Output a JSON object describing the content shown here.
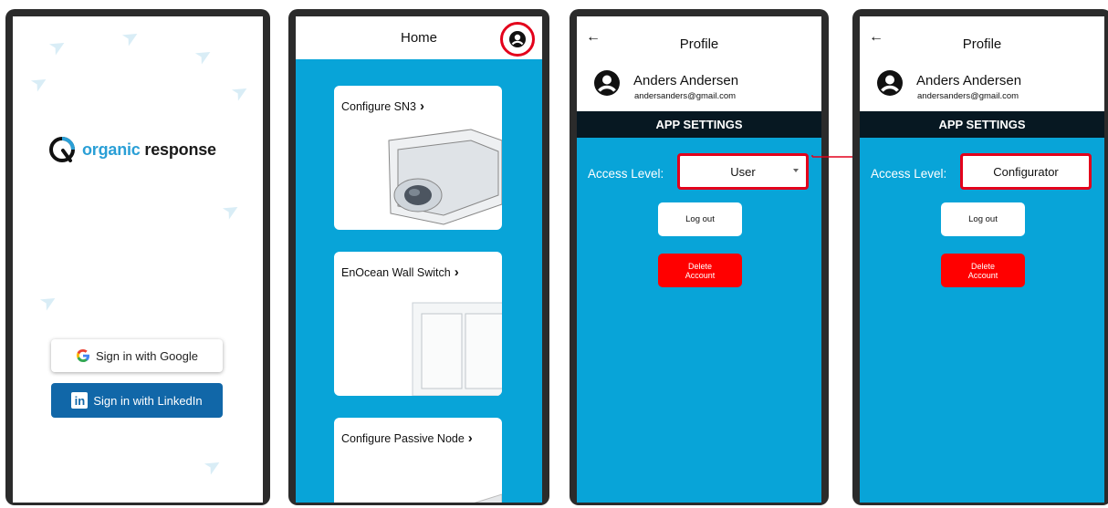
{
  "login": {
    "brand_left": "organic",
    "brand_right": " response",
    "google_label": "Sign in with Google",
    "linkedin_label": "Sign in with LinkedIn",
    "linkedin_mark": "in"
  },
  "home": {
    "title": "Home",
    "cards": [
      {
        "title": "Configure SN3",
        "icon": "sensor-device-image"
      },
      {
        "title": "EnOcean Wall Switch",
        "icon": "wall-switch-image"
      },
      {
        "title": "Configure Passive Node",
        "icon": "passive-node-image"
      }
    ]
  },
  "profile_user": {
    "title": "Profile",
    "back_glyph": "←",
    "name": "Anders Andersen",
    "email": "andersanders@gmail.com",
    "section": "APP SETTINGS",
    "access_label": "Access Level:",
    "access_value": "User",
    "logout": "Log out",
    "delete_line1": "Delete",
    "delete_line2": "Account"
  },
  "profile_config": {
    "title": "Profile",
    "back_glyph": "←",
    "name": "Anders Andersen",
    "email": "andersanders@gmail.com",
    "section": "APP SETTINGS",
    "access_label": "Access Level:",
    "access_value": "Configurator",
    "logout": "Log out",
    "delete_line1": "Delete",
    "delete_line2": "Account"
  },
  "colors": {
    "accent_blue": "#08a4d8",
    "highlight_red": "#e3001b",
    "linkedin_blue": "#1167a8",
    "delete_red": "#ff0000",
    "settings_bar": "#071822"
  }
}
